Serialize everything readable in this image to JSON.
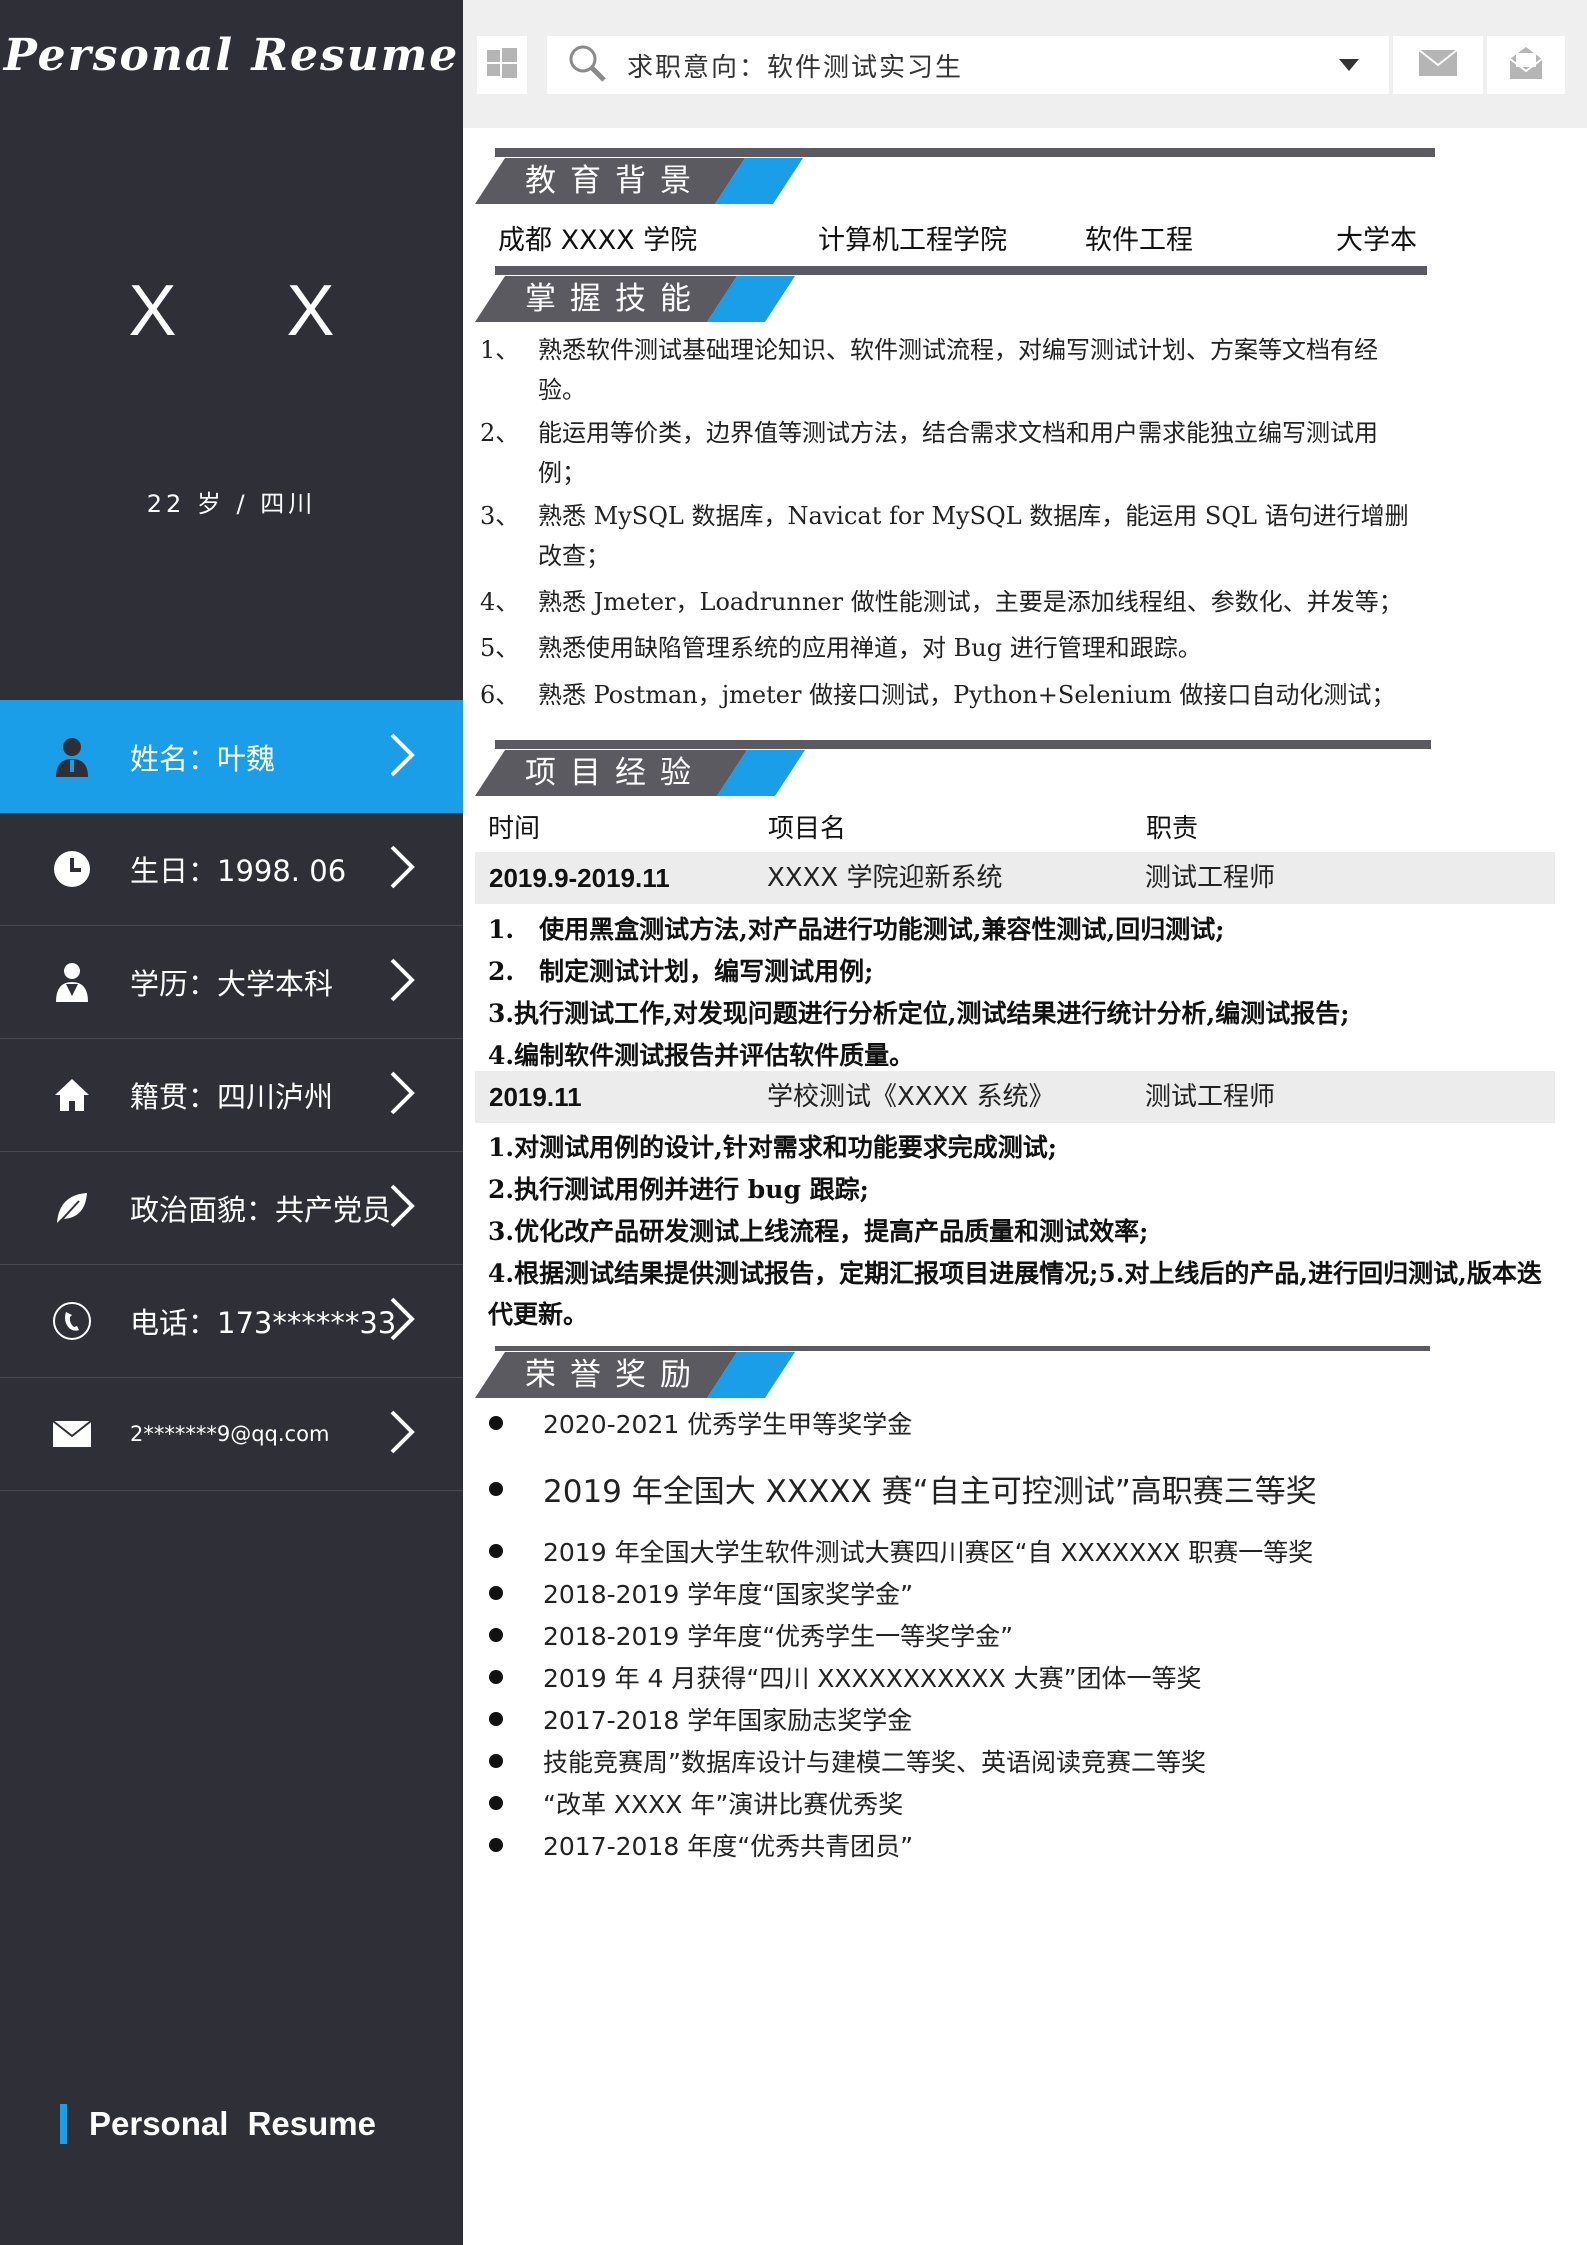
{
  "sidebar": {
    "brand": "Personal Resume",
    "name_display": "X X",
    "age_location": "22 岁 / 四川",
    "items": [
      {
        "icon": "person-icon",
        "label": "姓名：叶魏",
        "active": true
      },
      {
        "icon": "clock-icon",
        "label": "生日：1998. 06"
      },
      {
        "icon": "graduate-icon",
        "label": "学历：大学本科"
      },
      {
        "icon": "home-icon",
        "label": "籍贯：四川泸州"
      },
      {
        "icon": "leaf-icon",
        "label": "政治面貌：共产党员"
      },
      {
        "icon": "phone-icon",
        "label": "电话：173******33"
      },
      {
        "icon": "mail-icon",
        "label": "2*******9@qq.com"
      }
    ],
    "footer": "Personal Resume"
  },
  "topbar": {
    "search_text": "求职意向：软件测试实习生"
  },
  "education": {
    "title": "教育背景",
    "school": "成都 XXXX 学院",
    "college": "计算机工程学院",
    "major": "软件工程",
    "degree": "大学本"
  },
  "skills": {
    "title": "掌握技能",
    "items": [
      {
        "num": "1、",
        "text": "熟悉软件测试基础理论知识、软件测试流程，对编写测试计划、方案等文档有经验。"
      },
      {
        "num": "2、",
        "text": "能运用等价类，边界值等测试方法，结合需求文档和用户需求能独立编写测试用例；"
      },
      {
        "num": "3、",
        "text": "熟悉 MySQL 数据库，Navicat for MySQL 数据库，能运用 SQL 语句进行增删改查；"
      },
      {
        "num": "4、",
        "text": "熟悉 Jmeter，Loadrunner 做性能测试，主要是添加线程组、参数化、并发等；"
      },
      {
        "num": "5、",
        "text": "熟悉使用缺陷管理系统的应用禅道，对 Bug 进行管理和跟踪。"
      },
      {
        "num": "6、",
        "text": "熟悉 Postman，jmeter 做接口测试，Python+Selenium 做接口自动化测试；"
      }
    ]
  },
  "projects": {
    "title": "项目经验",
    "headers": {
      "time": "时间",
      "name": "项目名",
      "role": "职责"
    },
    "list": [
      {
        "time": "2019.9-2019.11",
        "name": "XXXX 学院迎新系统",
        "role": "测试工程师",
        "duties": [
          "1.　使用黑盒测试方法,对产品进行功能测试,兼容性测试,回归测试;",
          "2.　制定测试计划，编写测试用例;",
          "3.执行测试工作,对发现问题进行分析定位,测试结果进行统计分析,编测试报告;",
          "4.编制软件测试报告并评估软件质量。"
        ]
      },
      {
        "time": "2019.11",
        "name": "学校测试《XXXX 系统》",
        "role": "测试工程师",
        "duties": [
          "1.对测试用例的设计,针对需求和功能要求完成测试;",
          "2.执行测试用例并进行 bug 跟踪;",
          "3.优化改产品研发测试上线流程，提高产品质量和测试效率;",
          "4.根据测试结果提供测试报告，定期汇报项目进展情况;5.对上线后的产品,进行回归测试,版本迭代更新。"
        ]
      }
    ]
  },
  "honors": {
    "title": "荣誉奖励",
    "items": [
      "2020-2021 优秀学生甲等奖学金",
      "2019 年全国大 XXXXX 赛“自主可控测试”高职赛三等奖",
      "2019 年全国大学生软件测试大赛四川赛区“自 XXXXXXX 职赛一等奖",
      "2018-2019 学年度“国家奖学金”",
      "2018-2019 学年度“优秀学生一等奖学金”",
      "2019 年 4 月获得“四川 XXXXXXXXXXX 大赛”团体一等奖",
      "2017-2018 学年国家励志奖学金",
      "技能竞赛周”数据库设计与建模二等奖、英语阅读竞赛二等奖",
      "“改革 XXXX 年”演讲比赛优秀奖",
      "2017-2018 年度“优秀共青团员”"
    ]
  },
  "colors": {
    "sidebar": "#2f2f37",
    "accent": "#1a9ee8",
    "section_gray": "#5a5a60"
  }
}
